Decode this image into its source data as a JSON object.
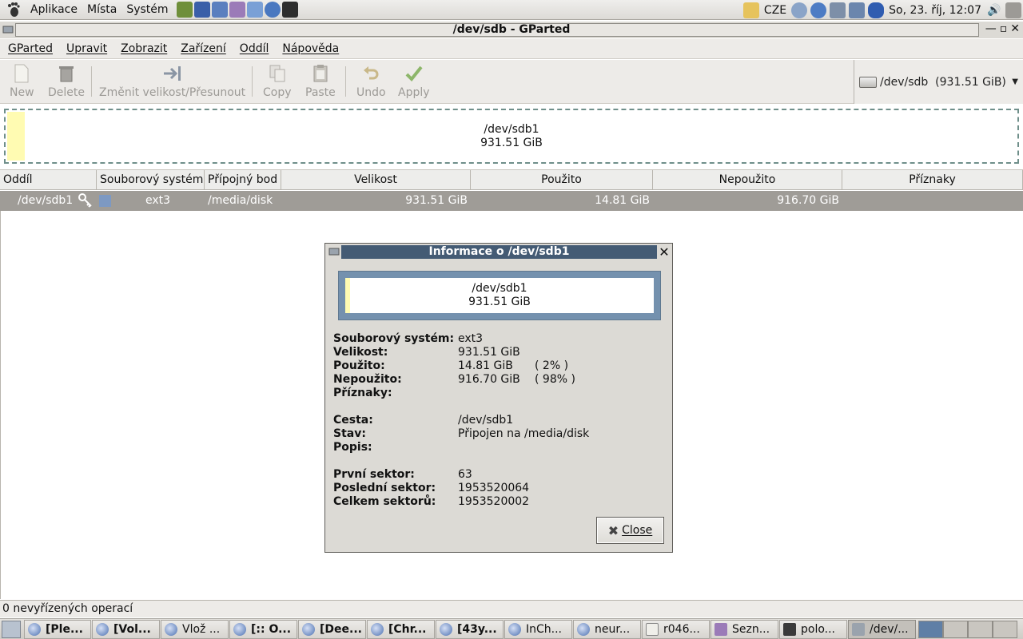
{
  "top_panel": {
    "menus": [
      "Aplikace",
      "Místa",
      "Systém"
    ],
    "keyboard_layout": "CZE",
    "clock": "So, 23. říj, 12:07"
  },
  "window": {
    "title": "/dev/sdb - GParted",
    "menubar": [
      "GParted",
      "Upravit",
      "Zobrazit",
      "Zařízení",
      "Oddíl",
      "Nápověda"
    ],
    "toolbar": {
      "new": "New",
      "delete": "Delete",
      "resize": "Změnit velikost/Přesunout",
      "copy": "Copy",
      "paste": "Paste",
      "undo": "Undo",
      "apply": "Apply"
    },
    "device_selector": "/dev/sdb  (931.51 GiB)"
  },
  "partition_map": {
    "name": "/dev/sdb1",
    "size": "931.51 GiB"
  },
  "table": {
    "headers": [
      "Oddíl",
      "Souborový systém",
      "Přípojný bod",
      "Velikost",
      "Použito",
      "Nepoužito",
      "Příznaky"
    ],
    "row": {
      "partition": "/dev/sdb1",
      "filesystem": "ext3",
      "mountpoint": "/media/disk",
      "size": "931.51 GiB",
      "used": "14.81 GiB",
      "unused": "916.70 GiB",
      "flags": ""
    }
  },
  "dialog": {
    "title": "Informace o /dev/sdb1",
    "map_name": "/dev/sdb1",
    "map_size": "931.51 GiB",
    "labels": {
      "filesystem": "Souborový systém:",
      "size": "Velikost:",
      "used": "Použito:",
      "unused": "Nepoužito:",
      "flags": "Příznaky:",
      "path": "Cesta:",
      "status": "Stav:",
      "description": "Popis:",
      "first_sector": "První sektor:",
      "last_sector": "Poslední sektor:",
      "total_sectors": "Celkem sektorů:"
    },
    "values": {
      "filesystem": "ext3",
      "size": "931.51 GiB",
      "used": "14.81 GiB",
      "used_pct": "( 2% )",
      "unused": "916.70 GiB",
      "unused_pct": "( 98% )",
      "flags": "",
      "path": "/dev/sdb1",
      "status": "Připojen na /media/disk",
      "description": "",
      "first_sector": "63",
      "last_sector": "1953520064",
      "total_sectors": "1953520002"
    },
    "close_label": "Close"
  },
  "statusbar": {
    "text": "0 nevyřízených operací"
  },
  "taskbar": [
    {
      "label": "[Ple...",
      "bold": true
    },
    {
      "label": "[Vol...",
      "bold": true
    },
    {
      "label": "Vlož ...",
      "bold": false
    },
    {
      "label": "[:: O...",
      "bold": true
    },
    {
      "label": "[Dee...",
      "bold": true
    },
    {
      "label": "[Chr...",
      "bold": true
    },
    {
      "label": "[43y...",
      "bold": true
    },
    {
      "label": "InCh...",
      "bold": false
    },
    {
      "label": "neur...",
      "bold": false
    },
    {
      "label": "r046...",
      "bold": false
    },
    {
      "label": "Sezn...",
      "bold": false
    },
    {
      "label": "polo...",
      "bold": false
    },
    {
      "label": "/dev/...",
      "bold": false
    }
  ],
  "colors": {
    "ext3": "#7d99c2",
    "unallocated_bar": "#fffbb2",
    "dialog_title": "#445b74",
    "selected_row": "#9f9c97"
  }
}
